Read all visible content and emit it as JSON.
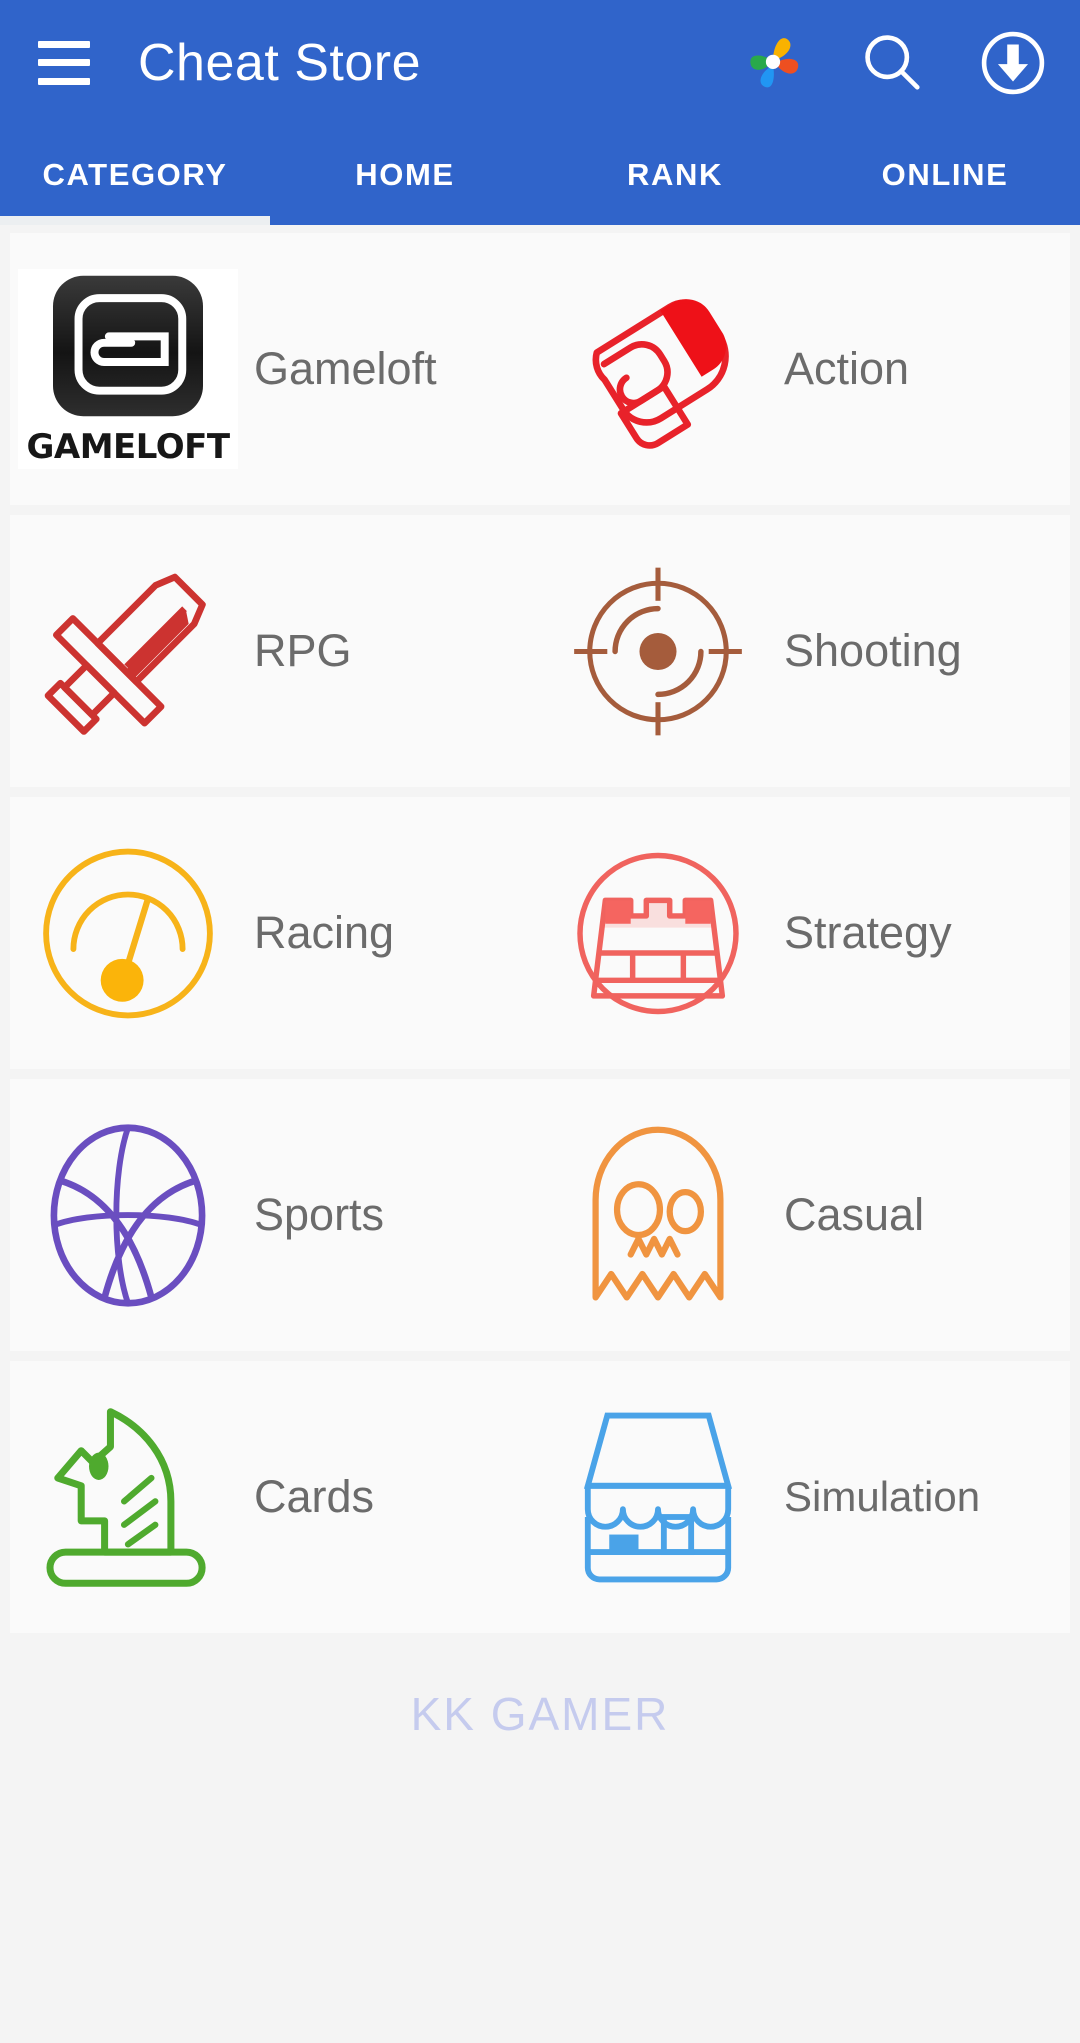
{
  "appbar": {
    "title": "Cheat Store",
    "menu_icon": "hamburger-menu-icon",
    "pinwheel_icon": "pinwheel-photos-icon",
    "search_icon": "search-icon",
    "download_icon": "download-circle-icon",
    "background_color": "#3064ca"
  },
  "tabs": {
    "items": [
      {
        "label": "CATEGORY",
        "active": true
      },
      {
        "label": "HOME",
        "active": false
      },
      {
        "label": "RANK",
        "active": false
      },
      {
        "label": "ONLINE",
        "active": false
      }
    ],
    "indicator_color": "#eceff1"
  },
  "categories": [
    {
      "label": "Gameloft",
      "icon": "gameloft-logo-icon",
      "color": "#2b2b2b"
    },
    {
      "label": "Action",
      "icon": "boxing-glove-icon",
      "color": "#e8222a"
    },
    {
      "label": "RPG",
      "icon": "sword-icon",
      "color": "#cc3330"
    },
    {
      "label": "Shooting",
      "icon": "crosshair-target-icon",
      "color": "#a55c3c"
    },
    {
      "label": "Racing",
      "icon": "speedometer-icon",
      "color": "#f7b319"
    },
    {
      "label": "Strategy",
      "icon": "castle-tower-icon",
      "color": "#f0635e"
    },
    {
      "label": "Sports",
      "icon": "basketball-icon",
      "color": "#6a4ec0"
    },
    {
      "label": "Casual",
      "icon": "ghost-icon",
      "color": "#f09440"
    },
    {
      "label": "Cards",
      "icon": "chess-knight-icon",
      "color": "#4faa2e"
    },
    {
      "label": "Simulation",
      "icon": "storefront-icon",
      "color": "#4aa3e8"
    }
  ],
  "gameloft_tile": {
    "wordmark": "GAMELOFT"
  },
  "watermark": {
    "text": "KK GAMER",
    "color": "#c5cbee"
  }
}
